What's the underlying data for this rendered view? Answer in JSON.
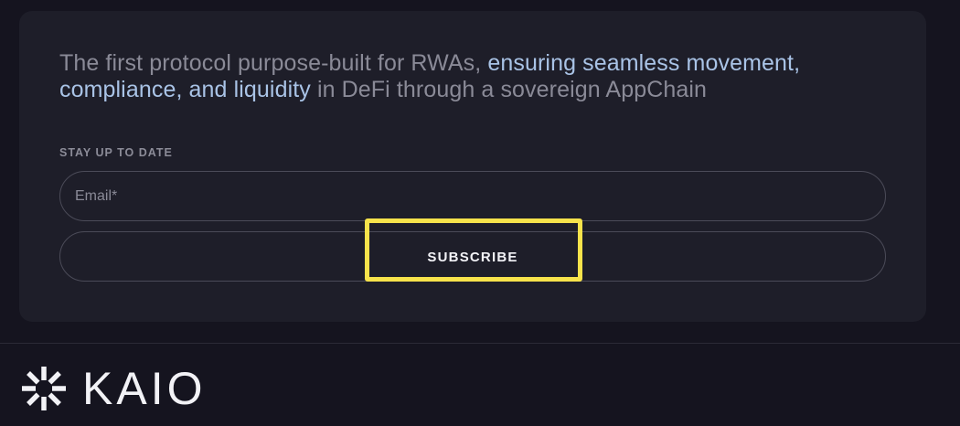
{
  "subscribe_card": {
    "tagline_muted_start": "The first protocol purpose-built for RWAs,",
    "tagline_highlight": "ensuring seamless movement, compliance, and liquidity",
    "tagline_muted_end": "in DeFi through a sovereign AppChain",
    "stay_label": "STAY UP TO DATE",
    "email_placeholder": "Email*",
    "email_value": "",
    "subscribe_label": "SUBSCRIBE"
  },
  "footer": {
    "logo_text": "KAIO"
  },
  "icons": {
    "logo": "kaio-burst-logo-icon"
  },
  "colors": {
    "background": "#15141f",
    "card": "#1e1e29",
    "muted_text": "#8a8a97",
    "highlight_text": "#a9c3e6",
    "button_text": "#f2f2f6",
    "field_border": "#4b4b58",
    "annotation": "#f7e34b"
  }
}
